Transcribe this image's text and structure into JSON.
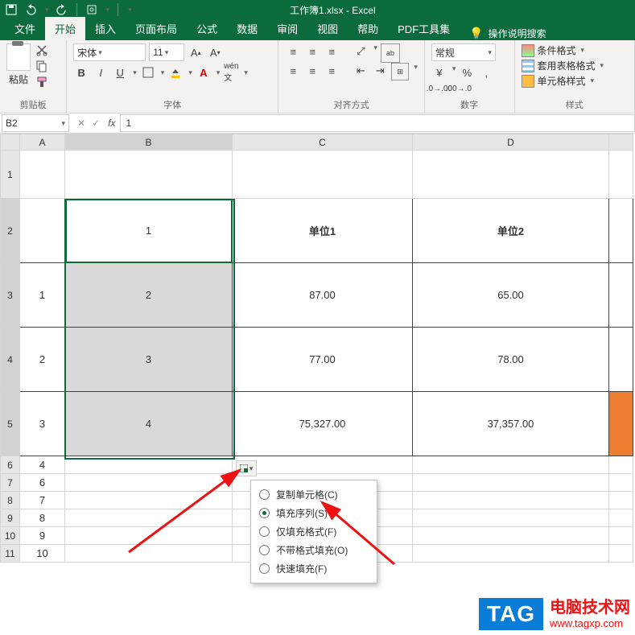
{
  "title": "工作簿1.xlsx - Excel",
  "tabs": {
    "file": "文件",
    "home": "开始",
    "insert": "插入",
    "layout": "页面布局",
    "formula": "公式",
    "data": "数据",
    "review": "审阅",
    "view": "视图",
    "help": "帮助",
    "pdf": "PDF工具集",
    "search": "操作说明搜索"
  },
  "ribbon": {
    "clipboard": {
      "paste": "粘贴",
      "label": "剪贴板"
    },
    "font": {
      "name": "宋体",
      "size": "11",
      "label": "字体"
    },
    "align": {
      "label": "对齐方式"
    },
    "number": {
      "format": "常规",
      "label": "数字"
    },
    "styles": {
      "cond": "条件格式",
      "table": "套用表格格式",
      "cell": "单元格样式",
      "label": "样式"
    }
  },
  "namebox": "B2",
  "formula": "1",
  "headers": {
    "A": "A",
    "B": "B",
    "C": "C",
    "D": "D"
  },
  "rows": {
    "1": "1",
    "2": "2",
    "3": "3",
    "4": "4",
    "5": "5",
    "6": "6",
    "7": "7",
    "8": "8",
    "9": "9",
    "10": "10",
    "11": "11"
  },
  "cells": {
    "B2": "1",
    "C2": "单位1",
    "D2": "单位2",
    "A3": "1",
    "B3": "2",
    "C3": "87.00",
    "D3": "65.00",
    "A4": "2",
    "B4": "3",
    "C4": "77.00",
    "D4": "78.00",
    "A5": "3",
    "B5": "4",
    "C5": "75,327.00",
    "D5": "37,357.00",
    "A6": "4",
    "A7": "6",
    "A8": "7",
    "A9": "8",
    "A10": "9",
    "A11": "10"
  },
  "fillmenu": {
    "copy": "复制单元格(C)",
    "series": "填充序列(S)",
    "fmtonly": "仅填充格式(F)",
    "nofmt": "不带格式填充(O)",
    "flash": "快速填充(F)"
  },
  "tag": {
    "box": "TAG",
    "line1": "电脑技术网",
    "line2": "www.tagxp.com"
  }
}
